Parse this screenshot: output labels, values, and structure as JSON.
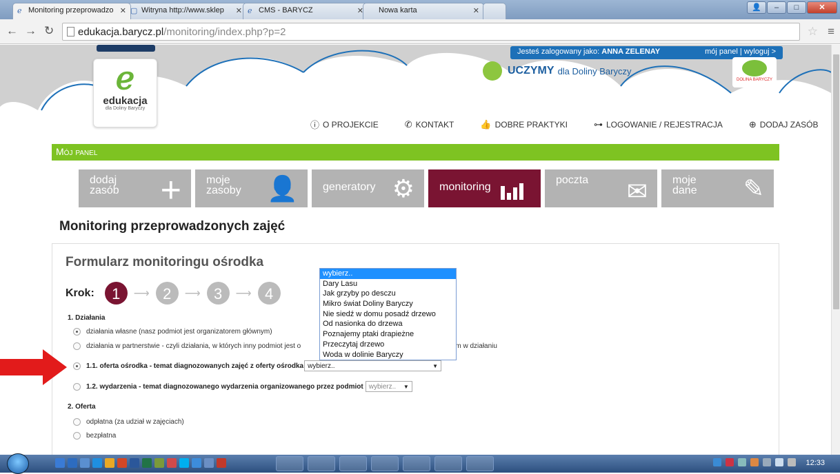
{
  "browser": {
    "tabs": [
      {
        "label": "Monitoring przeprowadzo",
        "icon": "edukacja-favicon"
      },
      {
        "label": "Witryna http://www.sklep",
        "icon": "page-icon"
      },
      {
        "label": "CMS - BARYCZ",
        "icon": "edukacja-favicon"
      },
      {
        "label": "Nowa karta",
        "icon": ""
      }
    ],
    "url_host": "edukacja.barycz.pl",
    "url_path": "/monitoring/index.php?p=2"
  },
  "header": {
    "logged_prefix": "Jesteś zalogowany jako:",
    "logged_user": "ANNA ZELENAY",
    "my_panel": "mój panel",
    "separator": "|",
    "logout": "wyloguj >",
    "tagline_bold": "UCZYMY",
    "tagline_rest": "dla Doliny Baryczy",
    "logo_title": "edukacja",
    "logo_sub": "dla Doliny Baryczy",
    "right_logo_text": "DOLINA BARYCZY",
    "nav": [
      {
        "label": "O PROJEKCIE",
        "icon": "info-icon"
      },
      {
        "label": "KONTAKT",
        "icon": "phone-icon"
      },
      {
        "label": "DOBRE PRAKTYKI",
        "icon": "thumbs-up-icon"
      },
      {
        "label": "LOGOWANIE / REJESTRACJA",
        "icon": "key-icon"
      },
      {
        "label": "DODAJ ZASÓB",
        "icon": "plus-circle-icon"
      }
    ]
  },
  "panel": {
    "bar_title": "Mój panel",
    "tiles": [
      {
        "line1": "dodaj",
        "line2": "zasób",
        "icon": "plus-icon"
      },
      {
        "line1": "moje",
        "line2": "zasoby",
        "icon": "person-icon"
      },
      {
        "line1": "generatory",
        "line2": "",
        "icon": "gear-icon"
      },
      {
        "line1": "monitoring",
        "line2": "",
        "icon": "bar-chart-icon"
      },
      {
        "line1": "poczta",
        "line2": "",
        "icon": "envelope-icon"
      },
      {
        "line1": "moje",
        "line2": "dane",
        "icon": "edit-icon"
      }
    ]
  },
  "page_title": "Monitoring przeprowadzonych zajęć",
  "form": {
    "title": "Formularz monitoringu ośrodka",
    "krok_label": "Krok:",
    "steps": [
      "1",
      "2",
      "3",
      "4"
    ],
    "section1": "1. Działania",
    "opt1": "działania własne (nasz podmiot jest organizatorem głównym)",
    "opt2a": "działania w partnerstwie - czyli działania, w których inny podmiot jest o",
    "opt2b": "rtnerem w działaniu",
    "opt3": "1.1. oferta ośrodka - temat diagnozowanych zajęć z oferty ośrodka",
    "opt3_select": "wybierz..",
    "opt4": "1.2. wydarzenia - temat diagnozowanego wydarzenia organizowanego przez podmiot",
    "opt4_select": "wybierz..",
    "section2": "2. Oferta",
    "opt5": "odpłatna (za udział w zajęciach)",
    "opt6": "bezpłatna"
  },
  "dropdown_options": [
    "wybierz..",
    "Dary Lasu",
    "Jak grzyby po desczu",
    "Mikro świat Doliny Baryczy",
    "Nie siedź w domu posadź drzewo",
    "Od nasionka do drzewa",
    "Poznajemy ptaki drapieżne",
    "Przeczytaj drzewo",
    "Woda w dolinie Baryczy"
  ],
  "taskbar": {
    "clock": "12:33"
  },
  "colors": {
    "accent_maroon": "#7a1432",
    "green": "#7ec322",
    "blue": "#1d70b8",
    "highlight": "#1e90ff"
  }
}
